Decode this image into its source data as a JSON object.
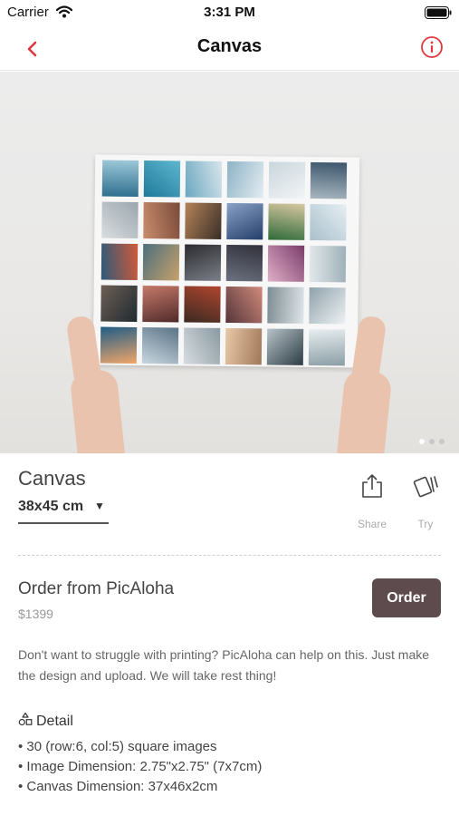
{
  "status_bar": {
    "carrier": "Carrier",
    "time": "3:31 PM"
  },
  "nav": {
    "title": "Canvas",
    "back_icon": "chevron-left-icon",
    "info_icon": "info-circle-icon",
    "accent_color": "#e0383e"
  },
  "hero": {
    "page_indicator": {
      "count": 3,
      "active": 0
    }
  },
  "product": {
    "name": "Canvas",
    "size": "38x45 cm",
    "actions": [
      {
        "label": "Share",
        "icon": "share-icon"
      },
      {
        "label": "Try",
        "icon": "try-cards-icon"
      }
    ]
  },
  "order": {
    "title": "Order from PicAloha",
    "price": "$1399",
    "button_label": "Order",
    "button_color": "#5e4b4e"
  },
  "description": "Don't want to struggle with printing? PicAloha can help on this. Just make the design and upload. We will take rest thing!",
  "detail": {
    "heading": "Detail",
    "icon": "shapes-icon",
    "items": [
      "• 30 (row:6, col:5) square images",
      "• Image Dimension: 2.75\"x2.75\" (7x7cm)",
      "• Canvas Dimension: 37x46x2cm"
    ]
  }
}
